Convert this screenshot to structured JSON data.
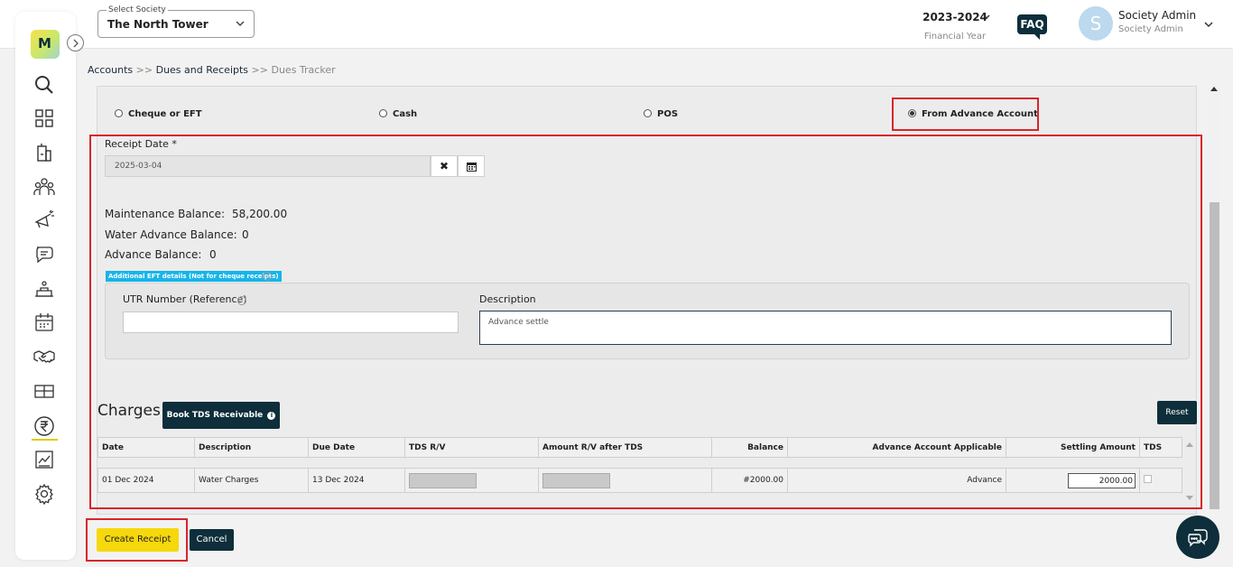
{
  "topbar": {
    "society_label": "Select Society",
    "society_value": "The North Tower",
    "financial_year": "2023-2024",
    "financial_year_label": "Financial Year",
    "faq": "FAQ",
    "avatar_letter": "S",
    "user_name": "Society Admin",
    "user_role": "Society Admin"
  },
  "sidebar": {
    "logo_text": "M",
    "items": [
      "search-icon",
      "dashboard-icon",
      "building-icon",
      "members-icon",
      "complaints-icon",
      "chat-icon",
      "amenities-icon",
      "calendar-icon",
      "handshake-icon",
      "parcel-icon",
      "rupee-icon",
      "reports-icon",
      "settings-icon"
    ],
    "active_item": "rupee-icon",
    "accent_color": "#e2c900"
  },
  "breadcrumb": {
    "items": [
      "Accounts",
      "Dues and Receipts",
      "Dues Tracker"
    ],
    "separator": ">>"
  },
  "payment_modes": {
    "options": [
      "Cheque or EFT",
      "Cash",
      "POS",
      "From Advance Account"
    ],
    "selected": "From Advance Account"
  },
  "receipt": {
    "date_label": "Receipt Date *",
    "date_value": "2025-03-04"
  },
  "balances": {
    "maintenance_label": "Maintenance Balance:",
    "maintenance_value": "58,200.00",
    "water_label": "Water Advance Balance:",
    "water_value": "0",
    "advance_label": "Advance Balance:",
    "advance_value": "0"
  },
  "eft": {
    "badge": "Additional EFT details (Not for cheque receipts)",
    "utr_label": "UTR Number (Reference)",
    "utr_value": "",
    "description_label": "Description",
    "description_value": "Advance settle"
  },
  "charges": {
    "title": "Charges",
    "book_tds_label": "Book TDS Receivable",
    "reset_label": "Reset",
    "columns": [
      "Date",
      "Description",
      "Due Date",
      "TDS R/V",
      "Amount R/V after TDS",
      "Balance",
      "Advance Account Applicable",
      "Settling Amount",
      "TDS"
    ],
    "rows": [
      {
        "date": "01 Dec 2024",
        "description": "Water Charges",
        "due_date": "13 Dec 2024",
        "balance": "#2000.00",
        "advance_applicable": "Advance",
        "settling_amount": "2000.00"
      }
    ]
  },
  "actions": {
    "create_label": "Create Receipt",
    "cancel_label": "Cancel"
  },
  "colors": {
    "primary_dark": "#0d2e3a",
    "highlight_red": "#d9252b",
    "create_yellow": "#f6d80d",
    "badge_blue": "#16b5e8"
  }
}
